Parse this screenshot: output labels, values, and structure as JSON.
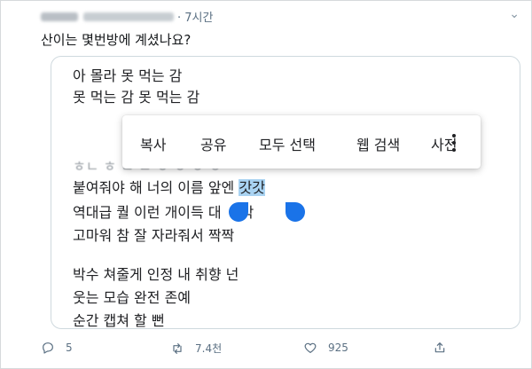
{
  "tweet": {
    "time": "· 7시간",
    "text": "산이는 몇번방에 계셨나요?"
  },
  "image": {
    "lyrics": [
      "아 몰라 못 먹는 감",
      "못 먹는 감 못 먹는 감",
      "붙여줘야 해 너의 이름 앞엔",
      "갓갓",
      "역대급 퀄 이런 개이득 대",
      "박",
      "고마워 참 잘 자라줘서 짝짝",
      "박수 쳐줄게 인정 내 취향 넌",
      "웃는 모습 완전 존예",
      "순간 캡쳐 할 뻔"
    ],
    "context_menu": [
      "복사",
      "공유",
      "모두 선택",
      "웹 검색",
      "사전"
    ]
  },
  "actions": {
    "replies": "5",
    "retweets": "7.4천",
    "likes": "925"
  },
  "colors": {
    "selection": "#a9d3f2",
    "handle": "#1a73e8",
    "secondary": "#5b7083"
  }
}
